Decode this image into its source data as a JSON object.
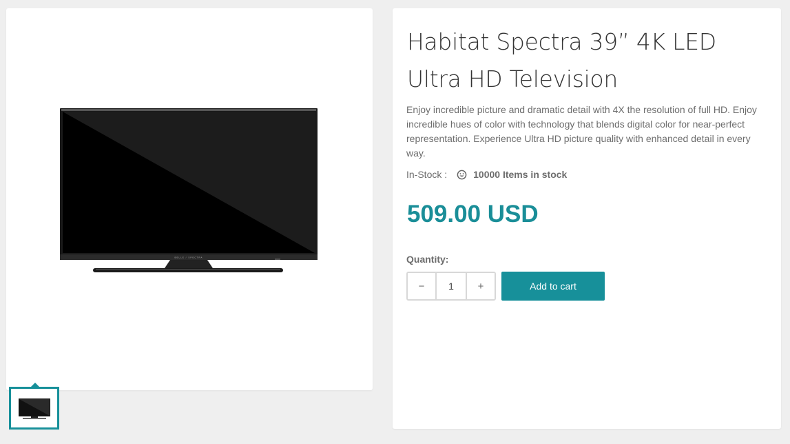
{
  "product": {
    "title": "Habitat Spectra 39” 4K LED Ultra HD Television",
    "description": "Enjoy incredible picture and dramatic detail with 4X the resolution of full HD. Enjoy incredible hues of color with technology that blends digital color for near-perfect representation. Experience Ultra HD picture quality with enhanced detail in every way.",
    "stock_label": "In-Stock :",
    "stock_icon": "smile-icon",
    "stock_count": "10000 Items in stock",
    "price": "509.00 USD",
    "image_brand_text": "BELLE / SPECTRA"
  },
  "purchase": {
    "quantity_label": "Quantity:",
    "minus_label": "−",
    "plus_label": "+",
    "quantity_value": "1",
    "add_to_cart_label": "Add to cart"
  },
  "colors": {
    "accent": "#17909a",
    "background": "#efefef"
  }
}
